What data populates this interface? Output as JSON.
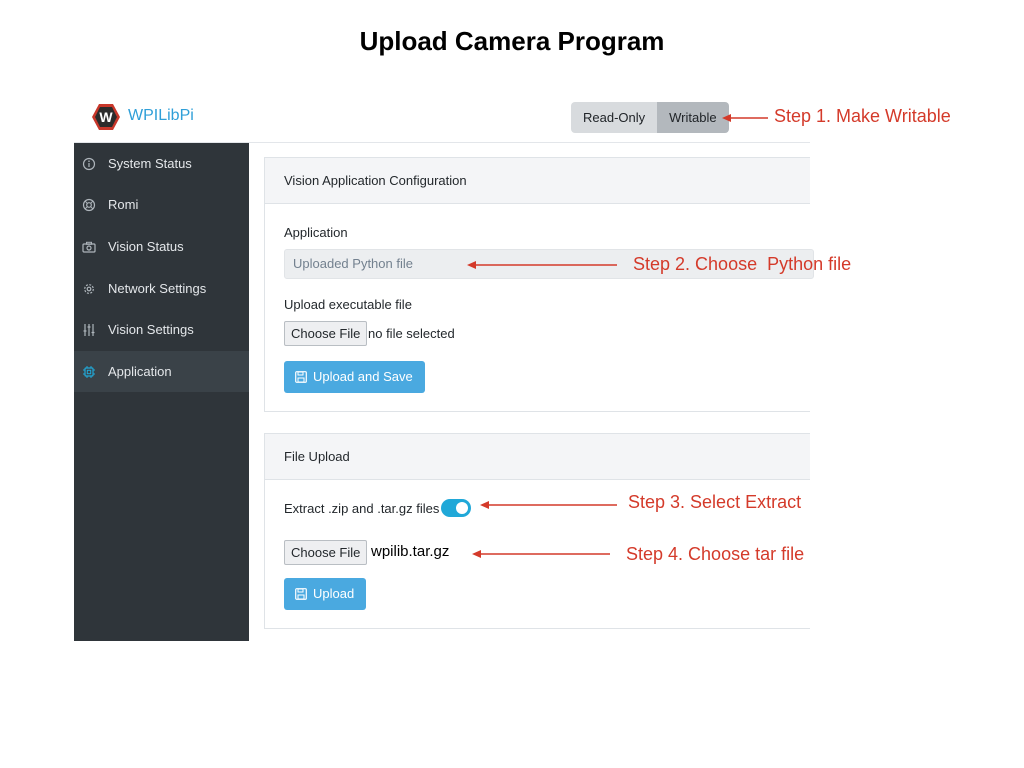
{
  "slide": {
    "title": "Upload Camera Program"
  },
  "header": {
    "logo_letter": "W",
    "brand": "WPILibPi",
    "mode_toggle": {
      "read_only": "Read-Only",
      "writable": "Writable",
      "active": "Writable"
    }
  },
  "sidebar": {
    "items": [
      {
        "label": "System Status",
        "icon": "info-circle-icon"
      },
      {
        "label": "Romi",
        "icon": "life-ring-icon"
      },
      {
        "label": "Vision Status",
        "icon": "camera-icon"
      },
      {
        "label": "Network Settings",
        "icon": "gear-icon"
      },
      {
        "label": "Vision Settings",
        "icon": "sliders-icon"
      },
      {
        "label": "Application",
        "icon": "chip-icon",
        "active": true
      }
    ]
  },
  "vision_app": {
    "header": "Vision Application Configuration",
    "application_label": "Application",
    "application_value": "Uploaded Python file",
    "upload_label": "Upload executable file",
    "choose_file": "Choose File",
    "file_status": "no file selected",
    "submit": "Upload and Save"
  },
  "file_upload": {
    "header": "File Upload",
    "extract_label": "Extract .zip and .tar.gz files",
    "extract_enabled": true,
    "choose_file": "Choose File",
    "file_name": "wpilib.tar.gz",
    "submit": "Upload"
  },
  "annotations": {
    "step1": "Step 1. Make Writable",
    "step2": "Step 2. Choose  Python file",
    "step3": "Step 3. Select Extract",
    "step4": "Step 4. Choose tar file",
    "color": "#d43a2a"
  },
  "colors": {
    "sidebar_bg": "#2f353a",
    "brand": "#2f9fd8",
    "primary_button": "#4aa9e0",
    "switch_on": "#20a8d8"
  }
}
